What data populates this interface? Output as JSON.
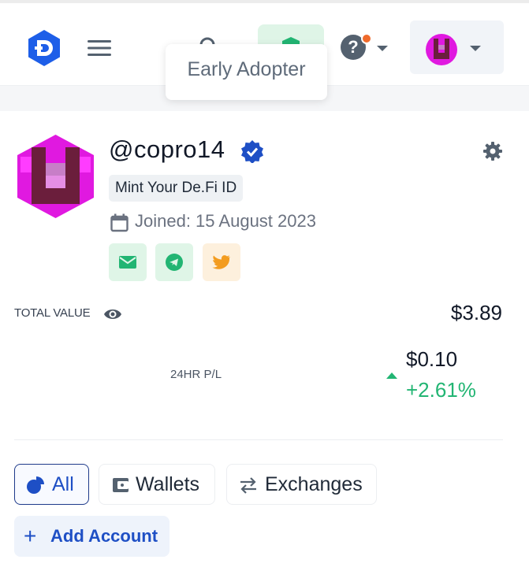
{
  "header": {
    "tooltip": "Early Adopter",
    "help_symbol": "?"
  },
  "profile": {
    "username": "@copro14",
    "badge": "Mint Your De.Fi ID",
    "joined": "Joined: 15 August 2023"
  },
  "summary": {
    "total_label": "TOTAL VALUE",
    "total_value": "$3.89",
    "pl_label": "24HR P/L",
    "pl_amount": "$0.10",
    "pl_percent": "+2.61%"
  },
  "tabs": [
    {
      "label": "All",
      "active": true
    },
    {
      "label": "Wallets",
      "active": false
    },
    {
      "label": "Exchanges",
      "active": false
    }
  ],
  "add_account": {
    "symbol": "+",
    "label": "Add Account"
  },
  "colors": {
    "brand_blue": "#1e4fc5",
    "positive_green": "#22b573",
    "avatar_magenta": "#e019e0"
  },
  "icons": [
    "defi-logo-icon",
    "menu-icon",
    "search-icon",
    "shield-icon",
    "help-icon",
    "chevron-down-icon",
    "verified-icon",
    "gear-icon",
    "calendar-icon",
    "email-icon",
    "telegram-icon",
    "twitter-icon",
    "eye-icon",
    "pie-icon",
    "wallet-icon",
    "swap-icon",
    "plus-icon"
  ]
}
